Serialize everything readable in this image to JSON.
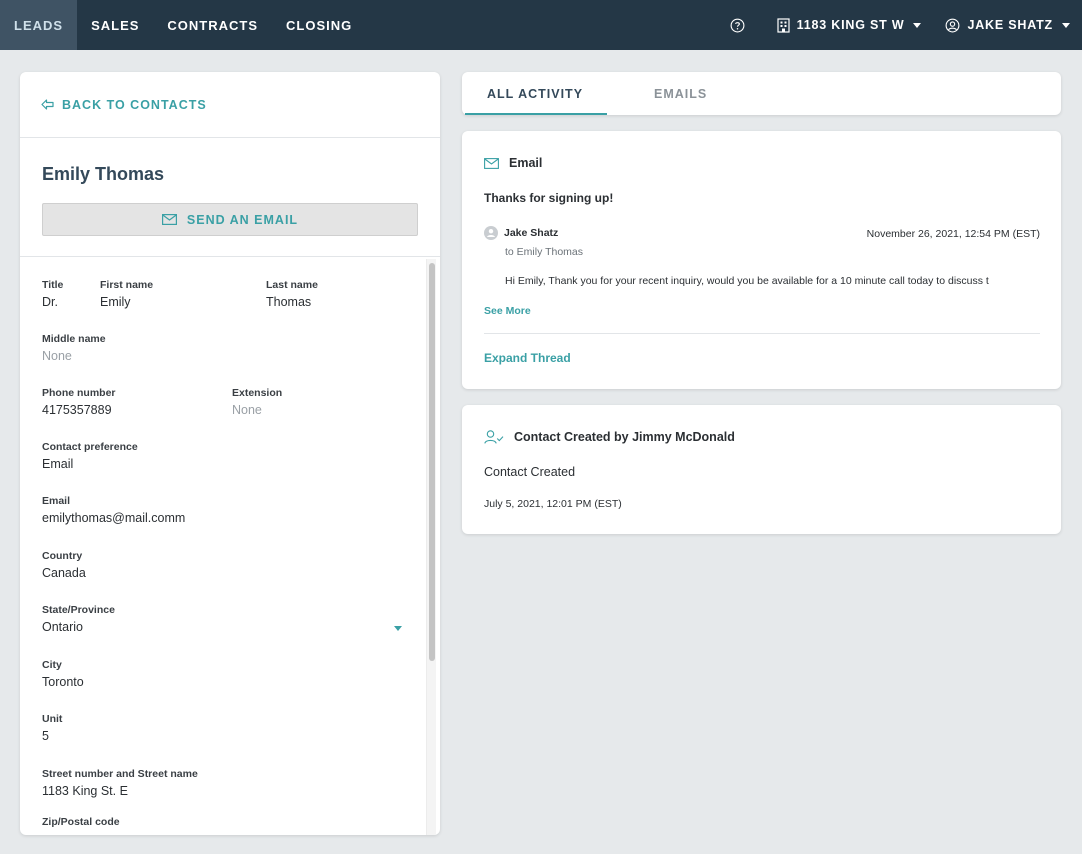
{
  "nav": {
    "tabs": [
      "LEADS",
      "SALES",
      "CONTRACTS",
      "CLOSING"
    ],
    "property": "1183 KING ST W",
    "user": "JAKE SHATZ"
  },
  "left": {
    "back_label": "BACK TO CONTACTS",
    "contact_name": "Emily Thomas",
    "send_email_label": "SEND AN EMAIL",
    "fields": {
      "title": {
        "label": "Title",
        "value": "Dr."
      },
      "first_name": {
        "label": "First name",
        "value": "Emily"
      },
      "last_name": {
        "label": "Last name",
        "value": "Thomas"
      },
      "middle_name": {
        "label": "Middle name",
        "value": "None"
      },
      "phone": {
        "label": "Phone number",
        "value": "4175357889"
      },
      "extension": {
        "label": "Extension",
        "value": "None"
      },
      "contact_pref": {
        "label": "Contact preference",
        "value": "Email"
      },
      "email": {
        "label": "Email",
        "value": "emilythomas@mail.comm"
      },
      "country": {
        "label": "Country",
        "value": "Canada"
      },
      "state": {
        "label": "State/Province",
        "value": "Ontario"
      },
      "city": {
        "label": "City",
        "value": "Toronto"
      },
      "unit": {
        "label": "Unit",
        "value": "5"
      },
      "street": {
        "label": "Street number and Street name",
        "value": "1183 King St. E"
      },
      "zip": {
        "label": "Zip/Postal code",
        "value": ""
      }
    }
  },
  "right": {
    "tabs": [
      "ALL ACTIVITY",
      "EMAILS"
    ],
    "email_card": {
      "type_label": "Email",
      "subject": "Thanks for signing up!",
      "sender": "Jake Shatz",
      "recipient": "to Emily Thomas",
      "timestamp": "November 26, 2021, 12:54 PM (EST)",
      "preview": "Hi Emily, Thank you for your recent inquiry, would you be available for a 10 minute call today to discuss t",
      "see_more": "See More",
      "expand_thread": "Expand Thread"
    },
    "contact_card": {
      "title": "Contact Created by Jimmy McDonald",
      "body": "Contact Created",
      "timestamp": "July 5, 2021, 12:01 PM (EST)"
    }
  },
  "colors": {
    "nav_bg": "#243746",
    "accent": "#3aa0a5",
    "page_bg": "#e6e9eb"
  }
}
